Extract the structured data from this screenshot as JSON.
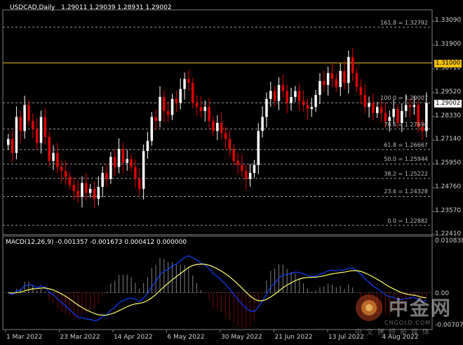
{
  "header": {
    "title": "USDCAD,Daily",
    "ohlc": "1.29011 1.29039 1.28931 1.29002"
  },
  "macd_title": "MACD(12,26,9) -0.001357 -0.001673 0.000412 0.000000",
  "price_axis": [
    "1.33090",
    "1.31900",
    "1.30710",
    "1.29520",
    "1.28330",
    "1.27140",
    "1.25950",
    "1.24760",
    "1.23570",
    "1.22410"
  ],
  "macd_axis": [
    "0.010838",
    "0.00",
    "-0.007076"
  ],
  "price_tags": {
    "level": "1.31000",
    "current": "1.29002",
    "level_color": "#f0c000",
    "current_color": "#ffffff"
  },
  "fibonacci": [
    {
      "label": "161.8 = 1.32792",
      "value": 1.32792
    },
    {
      "label": "100.0 = 1.29007",
      "value": 1.29007
    },
    {
      "label": "78.6 = 1.27696",
      "value": 1.27696
    },
    {
      "label": "61.8 = 1.26667",
      "value": 1.26667
    },
    {
      "label": "50.0 = 1.25944",
      "value": 1.25944
    },
    {
      "label": "38.2 = 1.25222",
      "value": 1.25222
    },
    {
      "label": "23.6 = 1.24328",
      "value": 1.24328
    },
    {
      "label": "0.0 = 1.22882",
      "value": 1.22882
    }
  ],
  "date_labels": [
    "1 Mar 2022",
    "23 Mar 2022",
    "14 Apr 2022",
    "6 May 2022",
    "30 May 2022",
    "21 Jun 2022",
    "13 Jul 2022",
    "4 Aug 2022"
  ],
  "watermark": {
    "name": "中金网",
    "url": "CNGOLD.COM",
    "sub": "中文财经新媒体"
  },
  "colors": {
    "background": "#000000",
    "bull": "#ffffff",
    "bear": "#e00000",
    "macd_line": "#1040ff",
    "signal_line": "#ffff66",
    "horizontal_level": "#f0c000"
  },
  "chart_data": [
    {
      "type": "candlestick",
      "title": "USDCAD,Daily",
      "ylim": [
        1.2241,
        1.3366
      ],
      "horizontal_level": 1.31,
      "last_close": 1.29002,
      "closes": [
        1.272,
        1.265,
        1.283,
        1.276,
        1.289,
        1.281,
        1.277,
        1.27,
        1.283,
        1.273,
        1.261,
        1.265,
        1.258,
        1.256,
        1.253,
        1.249,
        1.246,
        1.243,
        1.25,
        1.245,
        1.247,
        1.242,
        1.248,
        1.255,
        1.252,
        1.263,
        1.258,
        1.267,
        1.26,
        1.262,
        1.258,
        1.252,
        1.247,
        1.266,
        1.271,
        1.283,
        1.281,
        1.293,
        1.286,
        1.284,
        1.292,
        1.29,
        1.297,
        1.302,
        1.3,
        1.29,
        1.288,
        1.286,
        1.288,
        1.281,
        1.276,
        1.28,
        1.275,
        1.272,
        1.267,
        1.261,
        1.259,
        1.256,
        1.252,
        1.255,
        1.259,
        1.276,
        1.283,
        1.292,
        1.296,
        1.291,
        1.299,
        1.296,
        1.29,
        1.293,
        1.296,
        1.291,
        1.289,
        1.287,
        1.288,
        1.294,
        1.301,
        1.299,
        1.305,
        1.302,
        1.298,
        1.306,
        1.3,
        1.313,
        1.305,
        1.298,
        1.294,
        1.288,
        1.29,
        1.285,
        1.288,
        1.285,
        1.281,
        1.283,
        1.287,
        1.28,
        1.286,
        1.289,
        1.288,
        1.289,
        1.278,
        1.276,
        1.29
      ]
    },
    {
      "type": "macd",
      "params": "12,26,9",
      "ylim": [
        -0.007076,
        0.010838
      ],
      "values": {
        "macd": -0.001357,
        "signal": -0.001673,
        "histogram": 0.000412
      }
    }
  ]
}
